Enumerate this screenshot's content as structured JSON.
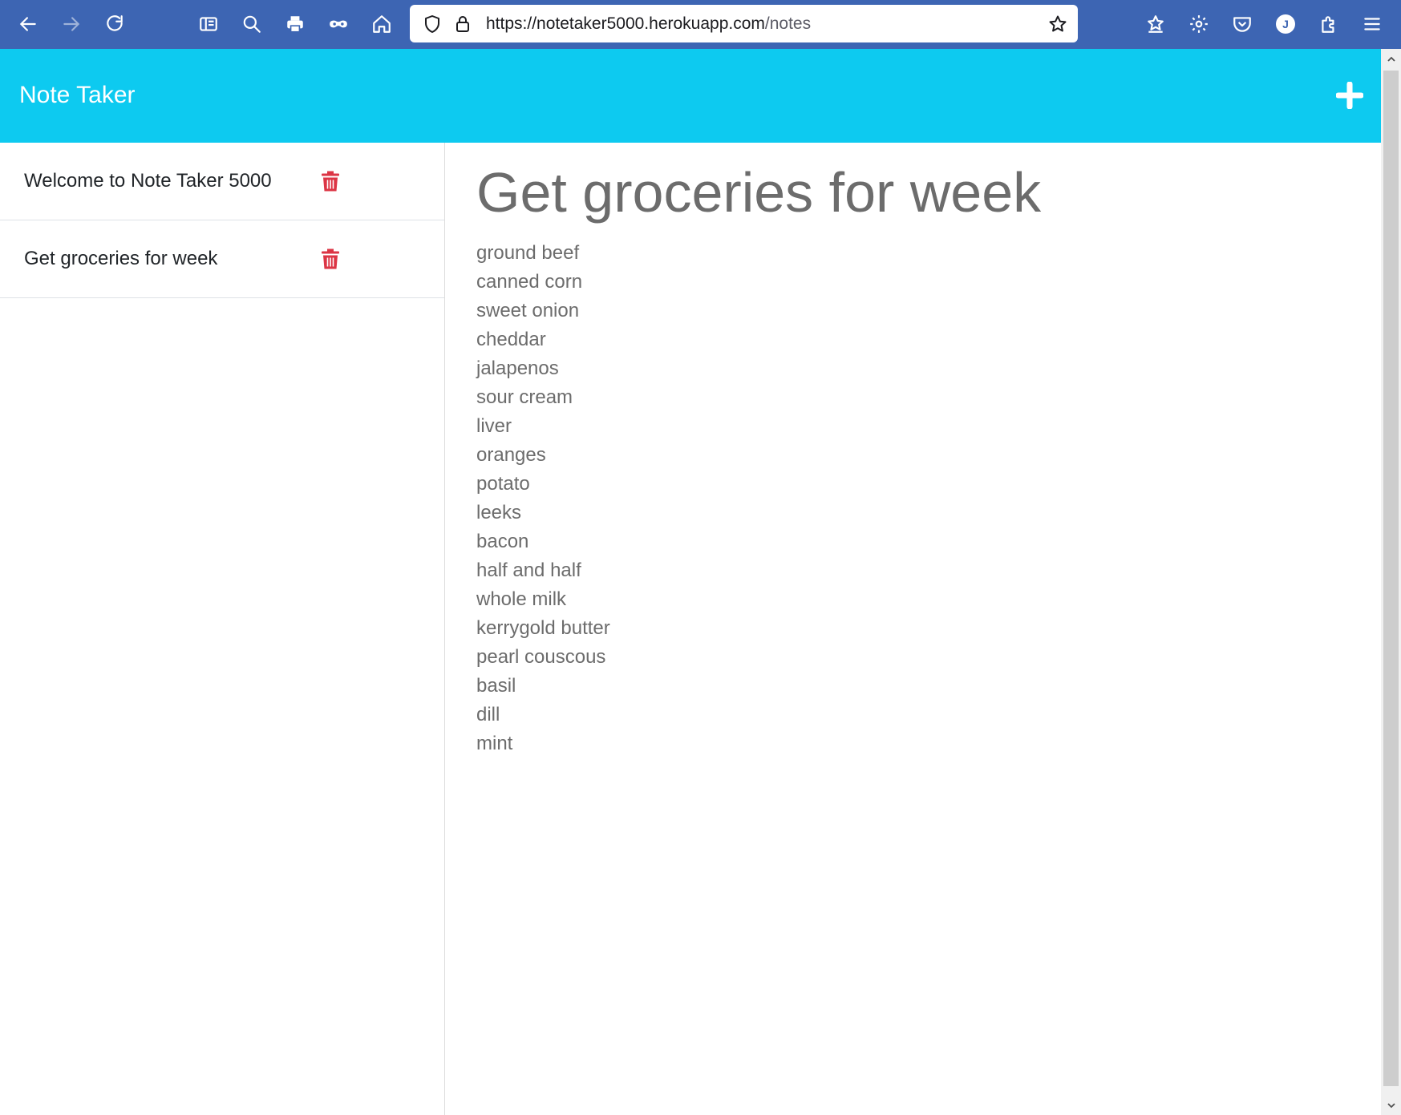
{
  "browser": {
    "url_host": "https://notetaker5000.herokuapp.com",
    "url_path": "/notes",
    "profile_initial": "J",
    "toolbar_icons": [
      "back-icon",
      "forward-icon",
      "reload-icon",
      "reader-view-icon",
      "search-icon",
      "print-icon",
      "private-browsing-icon",
      "home-icon"
    ],
    "url_icons": [
      "tracking-shield-icon",
      "lock-icon",
      "bookmark-star-icon"
    ],
    "right_icons": [
      "bookmarks-icon",
      "settings-gear-icon",
      "pocket-icon",
      "account-icon",
      "extensions-icon",
      "menu-icon"
    ]
  },
  "app": {
    "title": "Note Taker",
    "add_icon": "plus-icon",
    "accent_color": "#0dcaf0",
    "delete_color": "#dc3545"
  },
  "sidebar": {
    "notes": [
      {
        "title": "Welcome to Note Taker 5000"
      },
      {
        "title": "Get groceries for week"
      }
    ]
  },
  "active_note": {
    "title": "Get groceries for week",
    "lines": [
      "ground beef",
      "canned corn",
      "sweet onion",
      "cheddar",
      "jalapenos",
      "sour cream",
      "liver",
      "oranges",
      "potato",
      "leeks",
      "bacon",
      "half and half",
      "whole milk",
      "kerrygold butter",
      "pearl couscous",
      "basil",
      "dill",
      "mint"
    ]
  }
}
